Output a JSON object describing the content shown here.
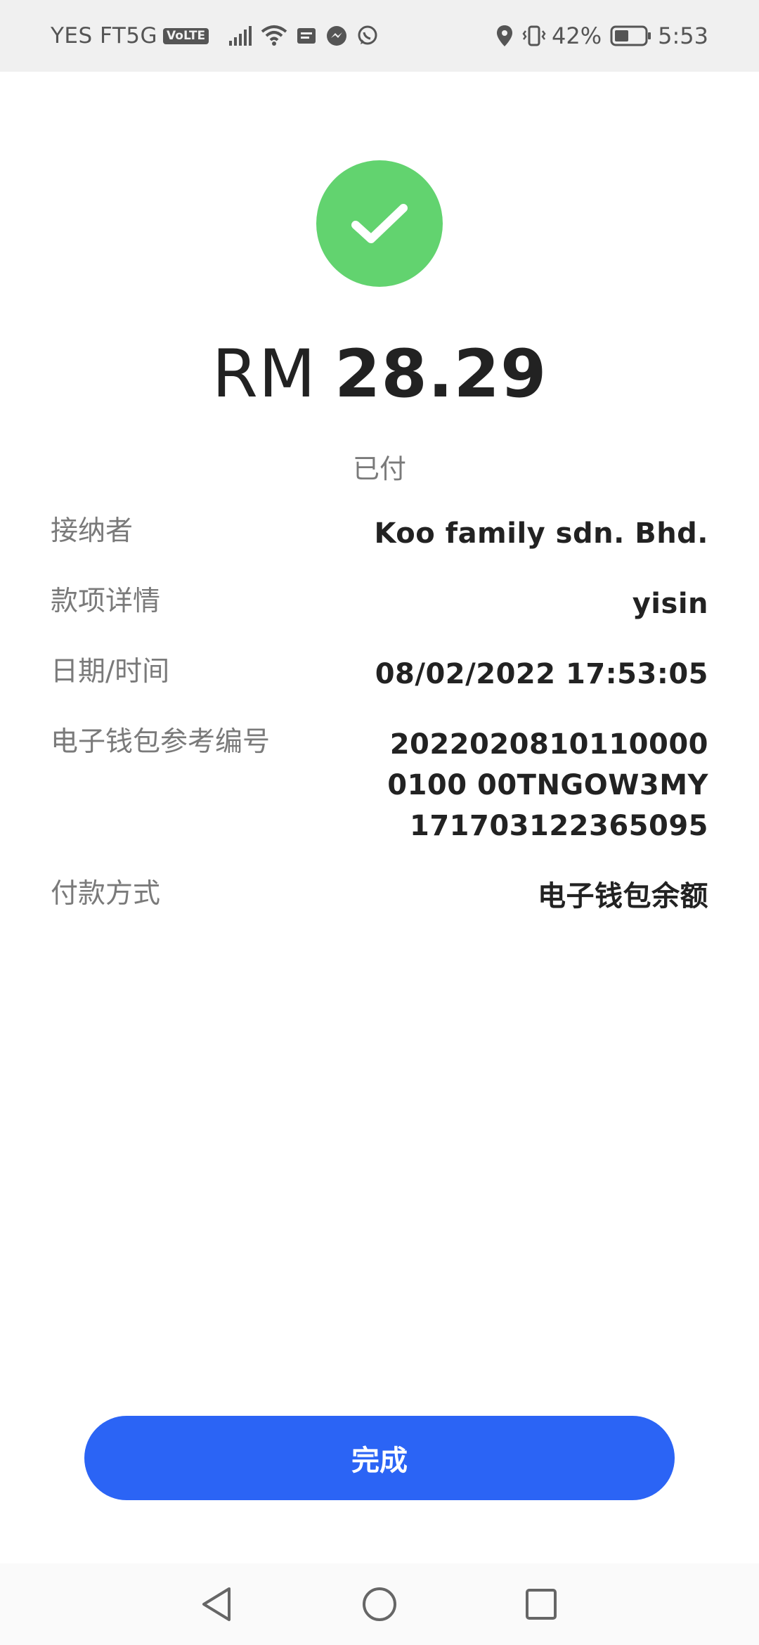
{
  "status_bar": {
    "carrier": "YES FT5G",
    "volte": "VoLTE",
    "battery": "42%",
    "time": "5:53"
  },
  "payment": {
    "currency": "RM",
    "amount": "28.29",
    "status": "已付"
  },
  "details": [
    {
      "label": "接纳者",
      "value": "Koo family sdn. Bhd."
    },
    {
      "label": "款项详情",
      "value": "yisin"
    },
    {
      "label": "日期/时间",
      "value": "08/02/2022 17:53:05"
    },
    {
      "label": "电子钱包参考编号",
      "value": "20220208101100000100 00TNGOW3MY171703122365095"
    },
    {
      "label": "付款方式",
      "value": "电子钱包余额"
    }
  ],
  "done_button": {
    "label": "完成"
  },
  "colors": {
    "success": "#62d36f",
    "primary": "#2b64f5",
    "status_bar_bg": "#f0f0f0"
  },
  "icons": {
    "success": "checkmark-icon",
    "nav_back": "back-triangle-icon",
    "nav_home": "home-circle-icon",
    "nav_recents": "recents-square-icon"
  }
}
